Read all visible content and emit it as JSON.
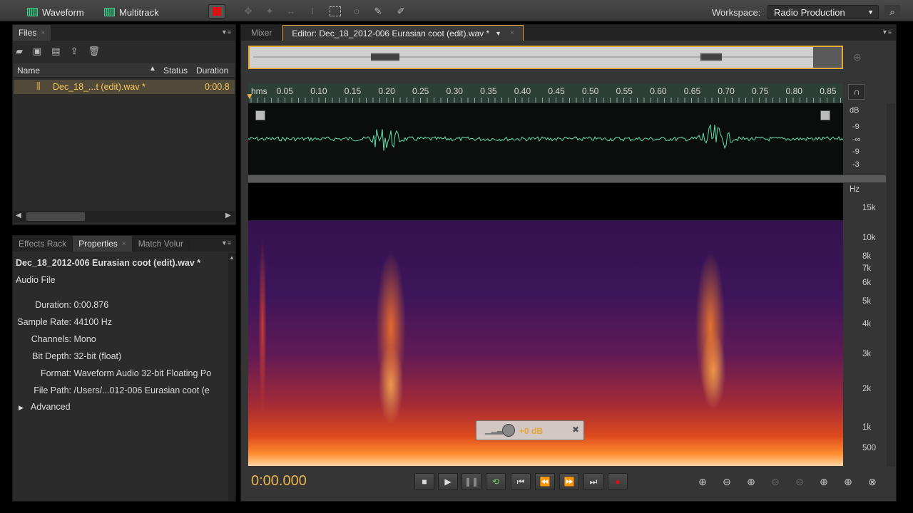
{
  "topbar": {
    "waveform_label": "Waveform",
    "multitrack_label": "Multitrack",
    "workspace_label": "Workspace:",
    "workspace_value": "Radio Production"
  },
  "files_panel": {
    "tab_label": "Files",
    "columns": [
      "Name",
      "Status",
      "Duration"
    ],
    "file": {
      "name": "Dec_18_...t (edit).wav *",
      "duration": "0:00.8"
    }
  },
  "props_panel": {
    "tabs": [
      "Effects Rack",
      "Properties",
      "Match Volur"
    ],
    "file_title": "Dec_18_2012-006 Eurasian coot (edit).wav *",
    "file_type": "Audio File",
    "rows": [
      {
        "key": "Duration:",
        "value": "0:00.876"
      },
      {
        "key": "Sample Rate:",
        "value": "44100 Hz"
      },
      {
        "key": "Channels:",
        "value": "Mono"
      },
      {
        "key": "Bit Depth:",
        "value": "32-bit (float)"
      },
      {
        "key": "Format:",
        "value": "Waveform Audio 32-bit Floating Po"
      },
      {
        "key": "File Path:",
        "value": "/Users/...012-006 Eurasian coot (e"
      }
    ],
    "advanced_label": "Advanced"
  },
  "editor": {
    "mixer_tab": "Mixer",
    "editor_tab": "Editor: Dec_18_2012-006 Eurasian coot (edit).wav *",
    "ruler_ticks": [
      "hms",
      "0.05",
      "0.10",
      "0.15",
      "0.20",
      "0.25",
      "0.30",
      "0.35",
      "0.40",
      "0.45",
      "0.50",
      "0.55",
      "0.60",
      "0.65",
      "0.70",
      "0.75",
      "0.80",
      "0.85"
    ],
    "db_scale": [
      "dB",
      "-9",
      "-∞",
      "-9",
      "-3"
    ],
    "hz_scale": [
      "Hz",
      "15k",
      "10k",
      "8k",
      "7k",
      "6k",
      "5k",
      "4k",
      "3k",
      "2k",
      "1k",
      "500"
    ],
    "gain_value": "+0 dB",
    "time_display": "0:00.000"
  },
  "colors": {
    "accent": "#e9b44c",
    "waveform": "#5fe3b0",
    "file_highlight": "#f6c65a"
  }
}
